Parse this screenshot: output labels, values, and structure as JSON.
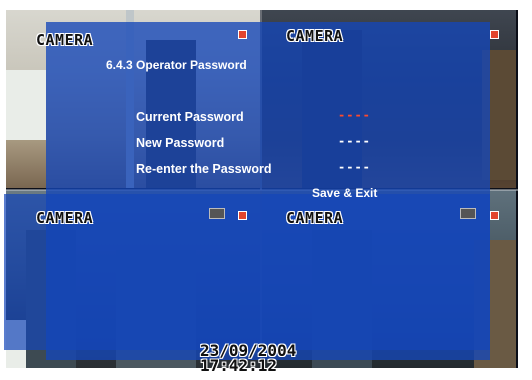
{
  "cameras": [
    {
      "label": "CAMERA"
    },
    {
      "label": "CAMERA"
    },
    {
      "label": "CAMERA"
    },
    {
      "label": "CAMERA"
    }
  ],
  "menu": {
    "title": "6.4.3 Operator Password",
    "fields": [
      {
        "label": "Current Password",
        "value": "----"
      },
      {
        "label": "New Password",
        "value": "----"
      },
      {
        "label": "Re-enter the Password",
        "value": "----"
      }
    ],
    "save_label": "Save & Exit"
  },
  "osd": {
    "date": "23/09/2004",
    "time": "17:42:12"
  },
  "colors": {
    "osd_panel": "#1446b9",
    "active_value": "#ff4a2c",
    "menu_text": "#ffffff"
  }
}
